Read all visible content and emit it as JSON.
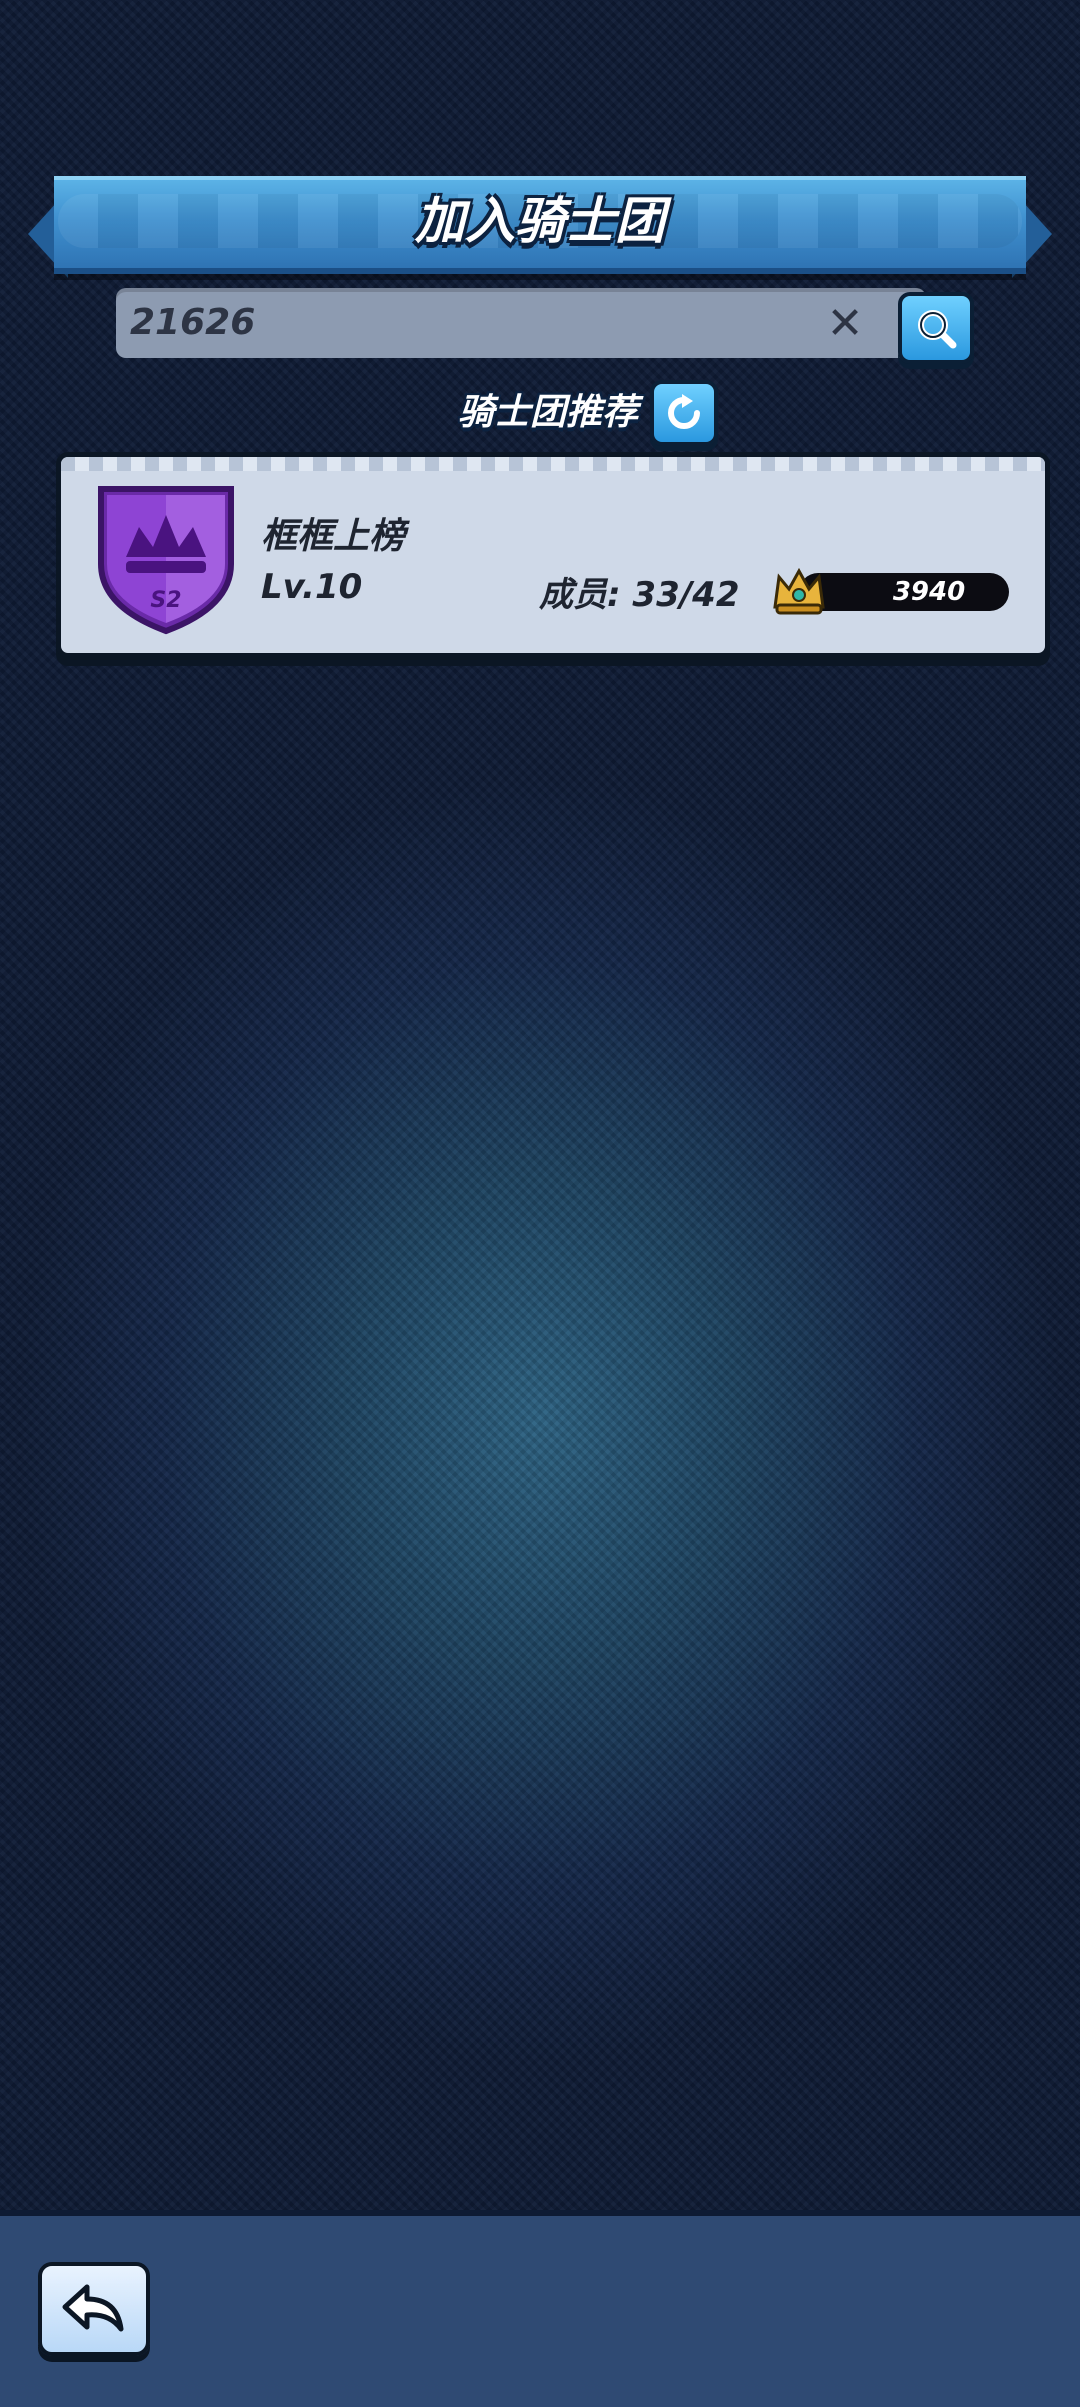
{
  "header": {
    "title": "加入骑士团"
  },
  "search": {
    "value": "21626"
  },
  "recommend": {
    "label": "骑士团推荐"
  },
  "guilds": [
    {
      "name": "框框上榜",
      "level": "Lv.10",
      "members": "成员: 33/42",
      "trophies": "3940",
      "emblem_text": "S2"
    }
  ],
  "icons": {
    "search": "search-icon",
    "clear": "close-icon",
    "refresh": "refresh-icon",
    "back": "back-arrow-icon",
    "crown": "crown-icon"
  },
  "colors": {
    "accent": "#3f90cf",
    "card_bg": "#cfd9e8",
    "emblem": "#8e44d4",
    "bottom_bar": "#2f4a73"
  }
}
